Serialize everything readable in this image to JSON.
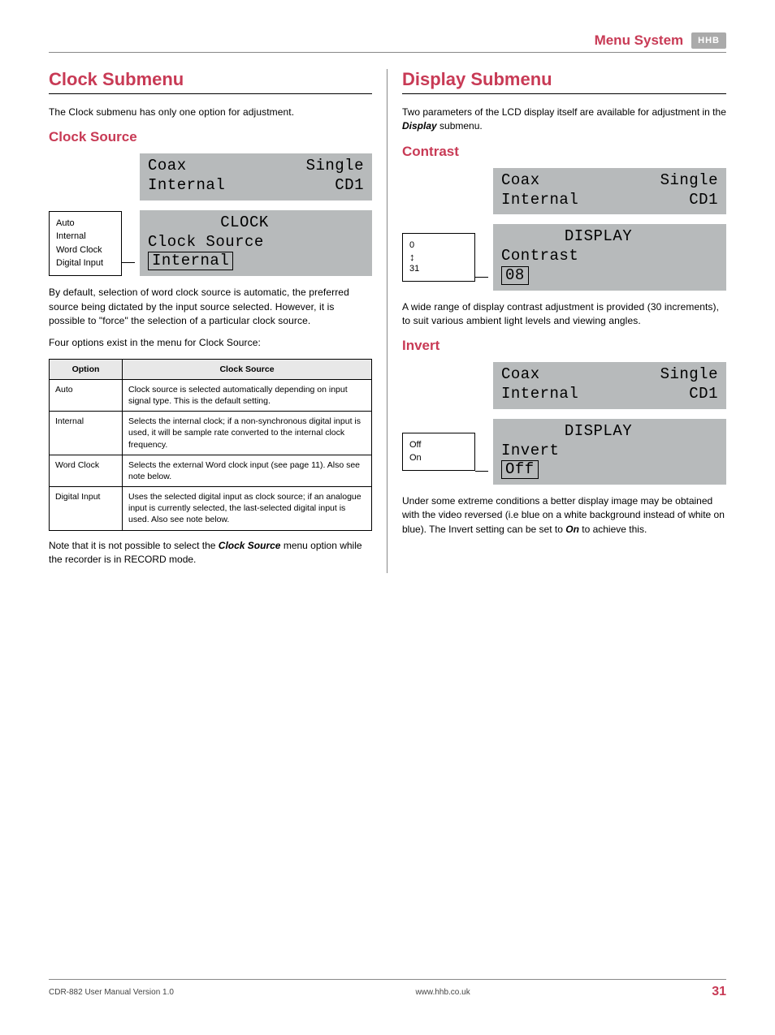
{
  "header": {
    "title": "Menu System",
    "brand": "HHB"
  },
  "left": {
    "title": "Clock Submenu",
    "intro": "The Clock submenu has only one option for adjustment.",
    "section_title": "Clock Source",
    "lcd_top": {
      "l1_left": "Coax",
      "l1_right": "Single",
      "l2_left": "Internal",
      "l2_right": "CD1"
    },
    "options": [
      "Auto",
      "Internal",
      "Word Clock",
      "Digital Input"
    ],
    "lcd_bottom": {
      "menu": "CLOCK",
      "label": "Clock Source",
      "value": "Internal"
    },
    "para1": "By default, selection of word clock source is automatic, the preferred source being dictated by the input source selected. However, it is possible to \"force\" the selection of a particular clock source.",
    "para2": "Four options exist in the menu for Clock Source:",
    "table": {
      "head_opt": "Option",
      "head_desc": "Clock Source",
      "rows": [
        {
          "opt": "Auto",
          "desc": "Clock source is selected automatically depending on input signal type. This is the default setting."
        },
        {
          "opt": "Internal",
          "desc": "Selects the internal clock; if a non-synchronous digital input is used, it will be sample rate converted to the internal clock frequency."
        },
        {
          "opt": "Word Clock",
          "desc": "Selects the external Word clock input (see page 11). Also see note below."
        },
        {
          "opt": "Digital Input",
          "desc": "Uses the selected digital input as clock source; if an analogue input is currently selected, the last-selected digital input is used. Also see note below."
        }
      ]
    },
    "note_pre": "Note that it is not possible to select the ",
    "note_bold": "Clock Source",
    "note_post": " menu option while the recorder is in RECORD mode."
  },
  "right": {
    "title": "Display Submenu",
    "intro_pre": "Two parameters of the LCD display itself are available for adjustment in the ",
    "intro_bold": "Display",
    "intro_post": " submenu.",
    "contrast": {
      "title": "Contrast",
      "lcd_top": {
        "l1_left": "Coax",
        "l1_right": "Single",
        "l2_left": "Internal",
        "l2_right": "CD1"
      },
      "range_top": "0",
      "range_bottom": "31",
      "lcd_bottom": {
        "menu": "DISPLAY",
        "label": "Contrast",
        "value": "08"
      },
      "desc": "A wide range of display contrast adjustment is provided (30 increments), to suit various ambient light levels and viewing angles."
    },
    "invert": {
      "title": "Invert",
      "lcd_top": {
        "l1_left": "Coax",
        "l1_right": "Single",
        "l2_left": "Internal",
        "l2_right": "CD1"
      },
      "options": [
        "Off",
        "On"
      ],
      "lcd_bottom": {
        "menu": "DISPLAY",
        "label": "Invert",
        "value": "Off"
      },
      "desc_pre": "Under some extreme conditions a better display image may be obtained with the video reversed (i.e blue on a white background instead of white on blue). The Invert setting can be set to ",
      "desc_bold": "On",
      "desc_post": " to achieve this."
    }
  },
  "footer": {
    "left": "CDR-882 User Manual Version 1.0",
    "center": "www.hhb.co.uk",
    "page": "31"
  }
}
